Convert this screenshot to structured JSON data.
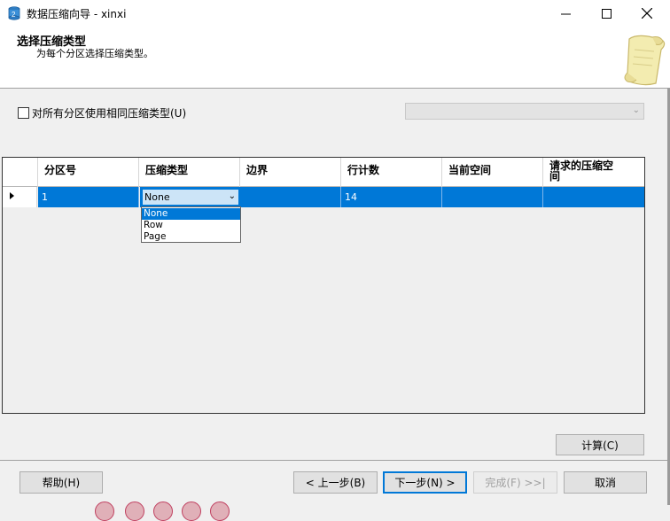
{
  "window": {
    "title": "数据压缩向导 - xinxi"
  },
  "header": {
    "title": "选择压缩类型",
    "subtitle": "为每个分区选择压缩类型。"
  },
  "options": {
    "same_type_label": "对所有分区使用相同压缩类型(U)",
    "same_type_checked": false
  },
  "grid": {
    "columns": [
      "分区号",
      "压缩类型",
      "边界",
      "行计数",
      "当前空间",
      "请求的压缩空\n间"
    ],
    "rows": [
      {
        "partition": "1",
        "compression": "None",
        "boundary": "",
        "row_count": "14",
        "current_space": "",
        "requested_space": ""
      }
    ],
    "dropdown_options": [
      "None",
      "Row",
      "Page"
    ],
    "dropdown_selected": "None"
  },
  "buttons": {
    "calculate": "计算(C)",
    "help": "帮助(H)",
    "back": "< 上一步(B)",
    "next": "下一步(N) >",
    "finish": "完成(F) >>|",
    "cancel": "取消"
  },
  "colors": {
    "selection": "#0078d7",
    "accent": "#0078d7"
  }
}
